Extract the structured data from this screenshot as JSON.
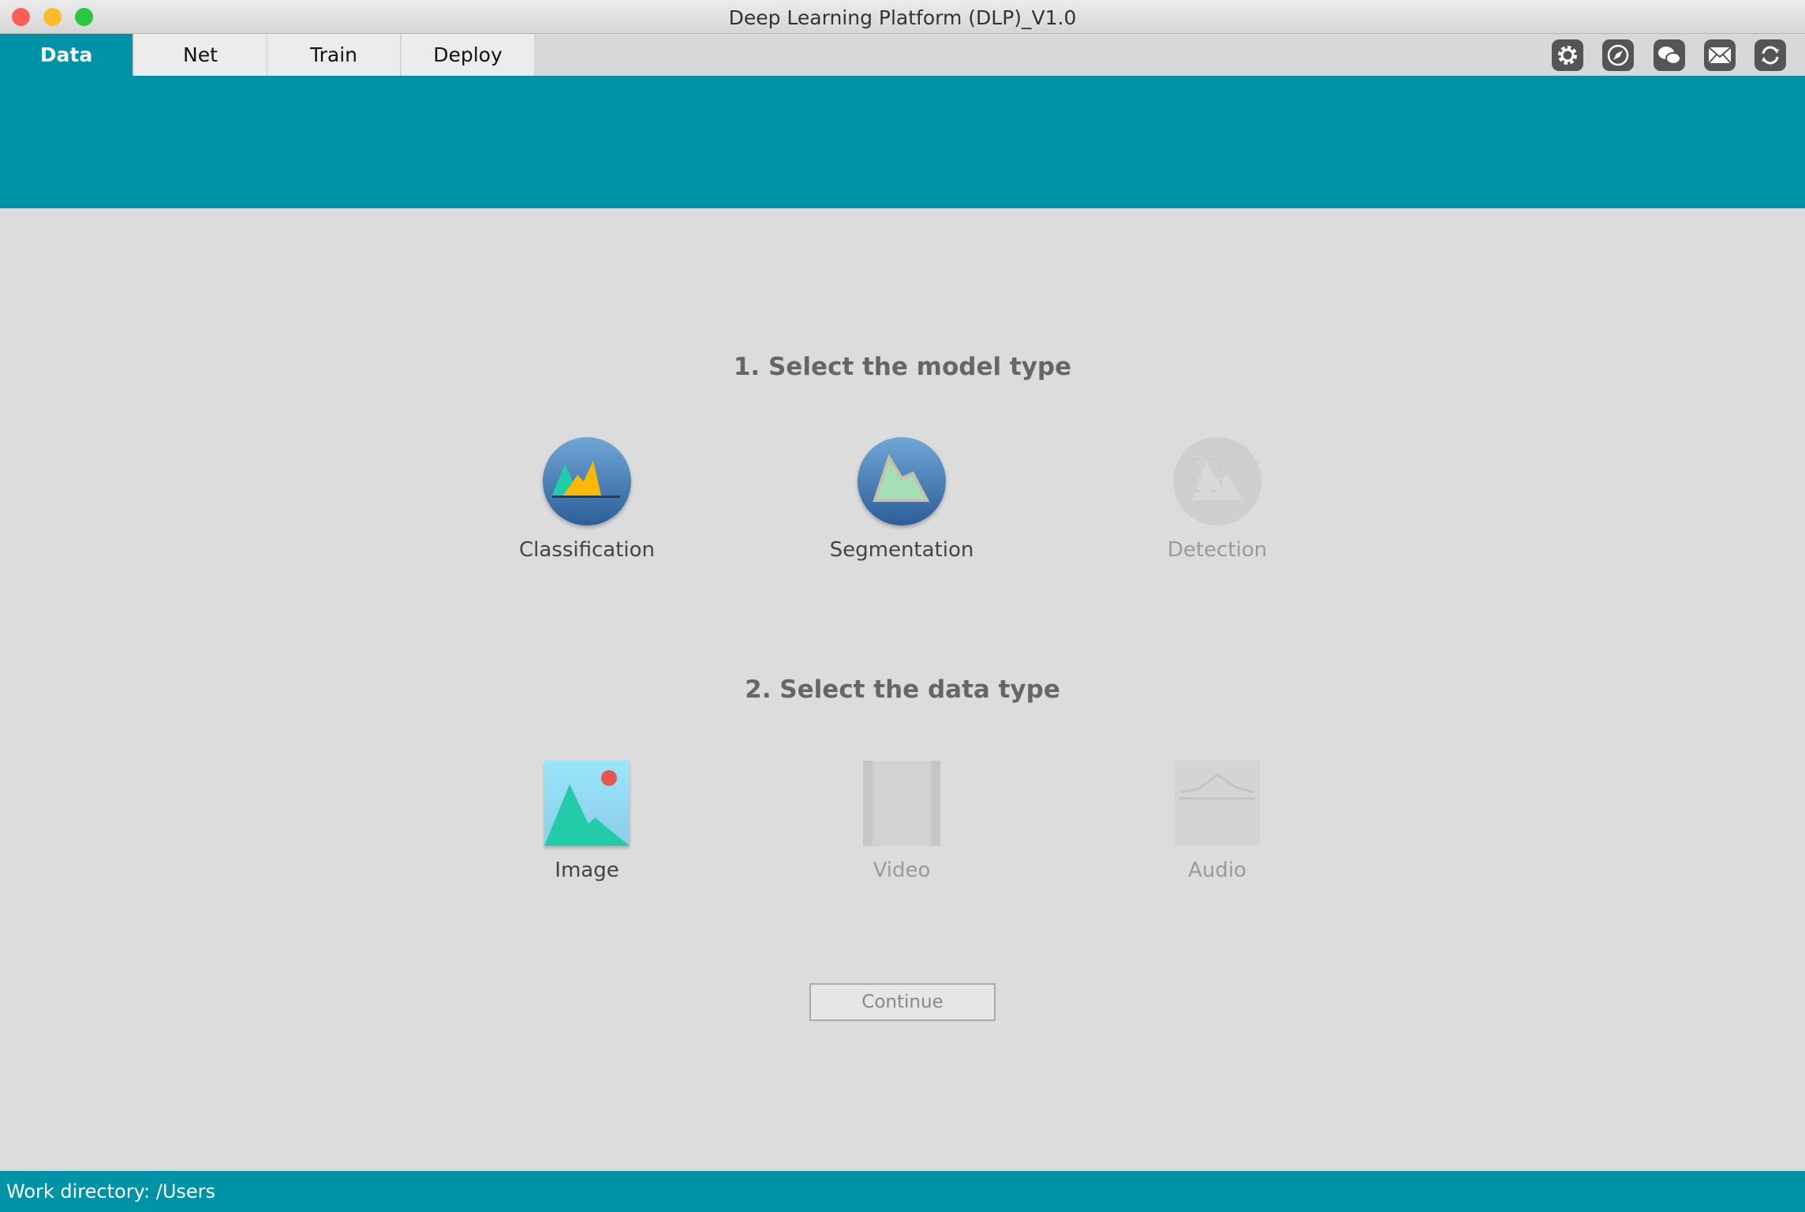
{
  "window": {
    "title": "Deep Learning Platform (DLP)_V1.0"
  },
  "tabs": [
    {
      "label": "Data",
      "active": true
    },
    {
      "label": "Net"
    },
    {
      "label": "Train"
    },
    {
      "label": "Deploy"
    }
  ],
  "toolbar": [
    "settings-icon",
    "compass-icon",
    "wechat-icon",
    "mail-icon",
    "refresh-icon"
  ],
  "step1": {
    "heading": "1. Select the model type",
    "options": [
      {
        "label": "Classification",
        "enabled": true
      },
      {
        "label": "Segmentation",
        "enabled": true
      },
      {
        "label": "Detection",
        "enabled": false
      }
    ]
  },
  "step2": {
    "heading": "2. Select the data type",
    "options": [
      {
        "label": "Image",
        "enabled": true
      },
      {
        "label": "Video",
        "enabled": false
      },
      {
        "label": "Audio",
        "enabled": false
      }
    ]
  },
  "continue_label": "Continue",
  "status": {
    "text": "Work directory:  /Users"
  },
  "colors": {
    "accent": "#0093a8",
    "background": "#dcdcdc"
  }
}
